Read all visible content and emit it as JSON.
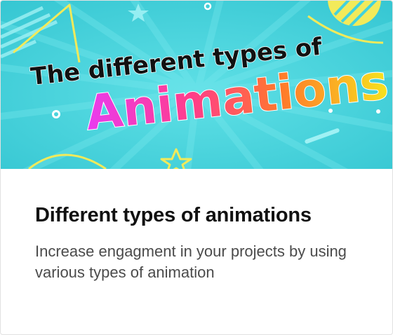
{
  "card": {
    "image": {
      "headline_line1": "The different types of",
      "headline_line2": "Animations"
    },
    "title": "Different types of animations",
    "description": "Increase engagment in your projects by using various types of animation"
  },
  "colors": {
    "hero_background": "#42d2dc",
    "accent_yellow": "#f2ea5a",
    "headline_dark": "#111111",
    "title_text": "#111111",
    "description_text": "#4b4b4b"
  }
}
